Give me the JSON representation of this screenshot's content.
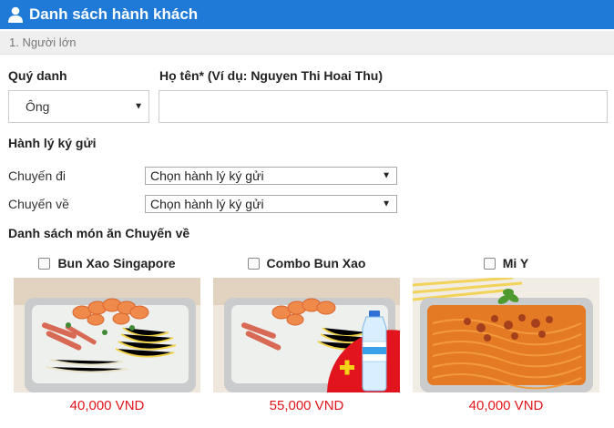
{
  "header": {
    "title": "Danh sách hành khách",
    "icon": "user-icon"
  },
  "section": {
    "label": "1. Người lớn"
  },
  "form": {
    "title_label": "Quý danh",
    "title_value": "Ông",
    "name_label": "Họ tên* (Ví dụ: Nguyen Thi Hoai Thu)",
    "name_value": ""
  },
  "baggage": {
    "heading": "Hành lý ký gửi",
    "rows": [
      {
        "label": "Chuyến đi",
        "value": "Chọn hành lý ký gửi"
      },
      {
        "label": "Chuyến về",
        "value": "Chọn hành lý ký gửi"
      }
    ]
  },
  "meals": {
    "heading": "Danh sách món ăn Chuyến về",
    "items": [
      {
        "name": "Bun Xao Singapore",
        "price": "40,000 VND",
        "checked": false
      },
      {
        "name": "Combo Bun Xao",
        "price": "55,000 VND",
        "checked": false
      },
      {
        "name": "Mi Y",
        "price": "40,000 VND",
        "checked": false
      }
    ]
  },
  "colors": {
    "header_bg": "#1e7ad6",
    "price": "#e0161c",
    "section_bg": "#efefef"
  }
}
